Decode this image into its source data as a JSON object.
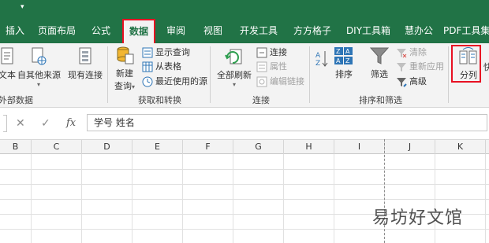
{
  "tabs": [
    "插入",
    "页面布局",
    "公式",
    "数据",
    "审阅",
    "视图",
    "开发工具",
    "方方格子",
    "DIY工具箱",
    "慧办公",
    "PDF工具集"
  ],
  "active_tab": "数据",
  "ribbon": {
    "external_data": {
      "group_label": "外部数据",
      "text_btn": "文本",
      "other_sources_btn": "自其他来源",
      "existing_conn_btn": "现有连接"
    },
    "get_transform": {
      "group_label": "获取和转换",
      "new_query_line1": "新建",
      "new_query_line2": "查询",
      "show_queries": "显示查询",
      "from_table": "从表格",
      "recent_sources": "最近使用的源"
    },
    "connections": {
      "group_label": "连接",
      "refresh_all_line1": "全部刷新",
      "connections": "连接",
      "properties": "属性",
      "edit_links": "编辑链接"
    },
    "sort_filter": {
      "group_label": "排序和筛选",
      "sort": "排序",
      "filter": "筛选",
      "clear": "清除",
      "reapply": "重新应用",
      "advanced": "高级"
    },
    "data_tools": {
      "split_columns": "分列",
      "partial_label": "快"
    }
  },
  "formula_bar": {
    "cancel": "✕",
    "enter": "✓",
    "fx": "fx",
    "value": "学号 姓名"
  },
  "columns": [
    "B",
    "C",
    "D",
    "E",
    "F",
    "G",
    "H",
    "I",
    "J",
    "K"
  ],
  "watermark": "易坊好文馆",
  "colors": {
    "ribbon_green": "#217346",
    "highlight_red": "#e81123"
  }
}
